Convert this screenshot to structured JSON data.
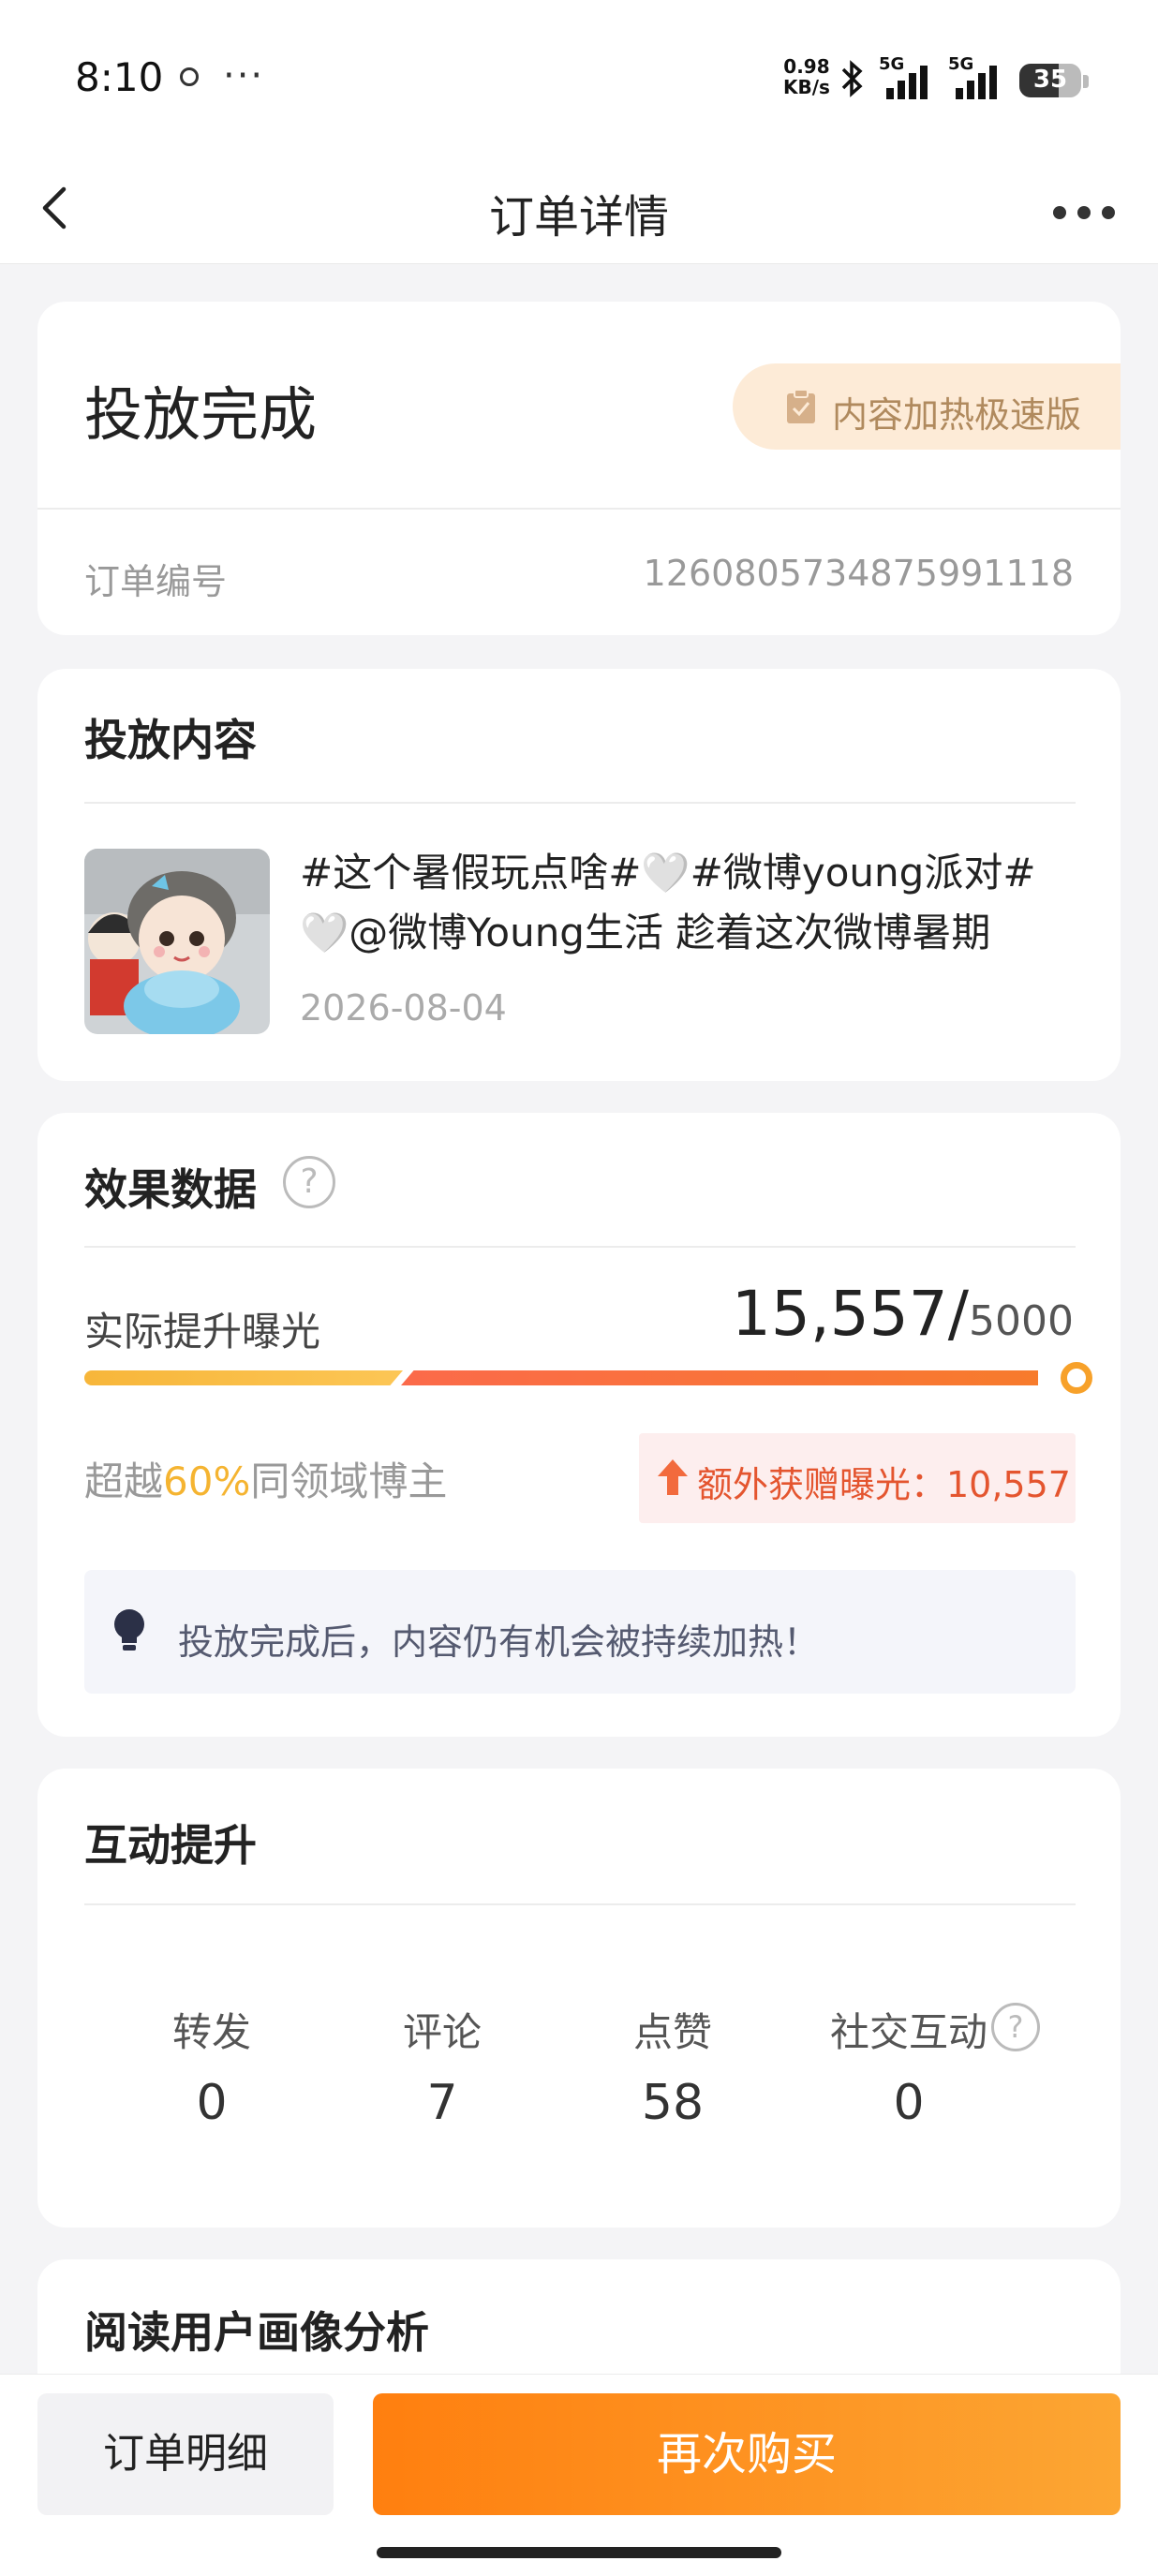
{
  "status_bar": {
    "time": "8:10",
    "more": "···",
    "net_speed_value": "0.98",
    "net_speed_unit": "KB/s",
    "signal1": "5G",
    "signal2": "5G",
    "battery": "35"
  },
  "nav": {
    "title": "订单详情",
    "back_icon": "chevron-left-icon",
    "more_icon": "more-dots-icon"
  },
  "order_status": {
    "title": "投放完成",
    "badge": "内容加热极速版",
    "order_no_label": "订单编号",
    "order_no_value": "1260805734875991118"
  },
  "content": {
    "section_title": "投放内容",
    "post_line1": "#这个暑假玩点啥#🤍#微博young派对#",
    "post_line2": "🤍@微博Young生活 趁着这次微博暑期",
    "post_date": "2026-08-04"
  },
  "effect": {
    "section_title": "效果数据",
    "help": "?",
    "metric_label": "实际提升曝光",
    "actual": "15,557/",
    "target": "5000",
    "progress_fraction": 1.0,
    "exceed_prefix": "超越",
    "exceed_percent": "60%",
    "exceed_suffix": "同领域博主",
    "extra_text": "额外获赠曝光：10,557",
    "tip_text": "投放完成后，内容仍有机会被持续加热！"
  },
  "interaction": {
    "section_title": "互动提升",
    "stats": [
      {
        "label": "转发",
        "value": "0"
      },
      {
        "label": "评论",
        "value": "7"
      },
      {
        "label": "点赞",
        "value": "58"
      },
      {
        "label": "社交互动",
        "value": "0"
      }
    ],
    "help": "?"
  },
  "audience": {
    "section_title": "阅读用户画像分析"
  },
  "bottom": {
    "detail_button": "订单明细",
    "buy_button": "再次购买"
  },
  "colors": {
    "accent_orange": "#ff7f0f",
    "badge_bg": "#fdebd7",
    "highlight_yellow": "#f5b431",
    "extra_red": "#e4552f"
  }
}
